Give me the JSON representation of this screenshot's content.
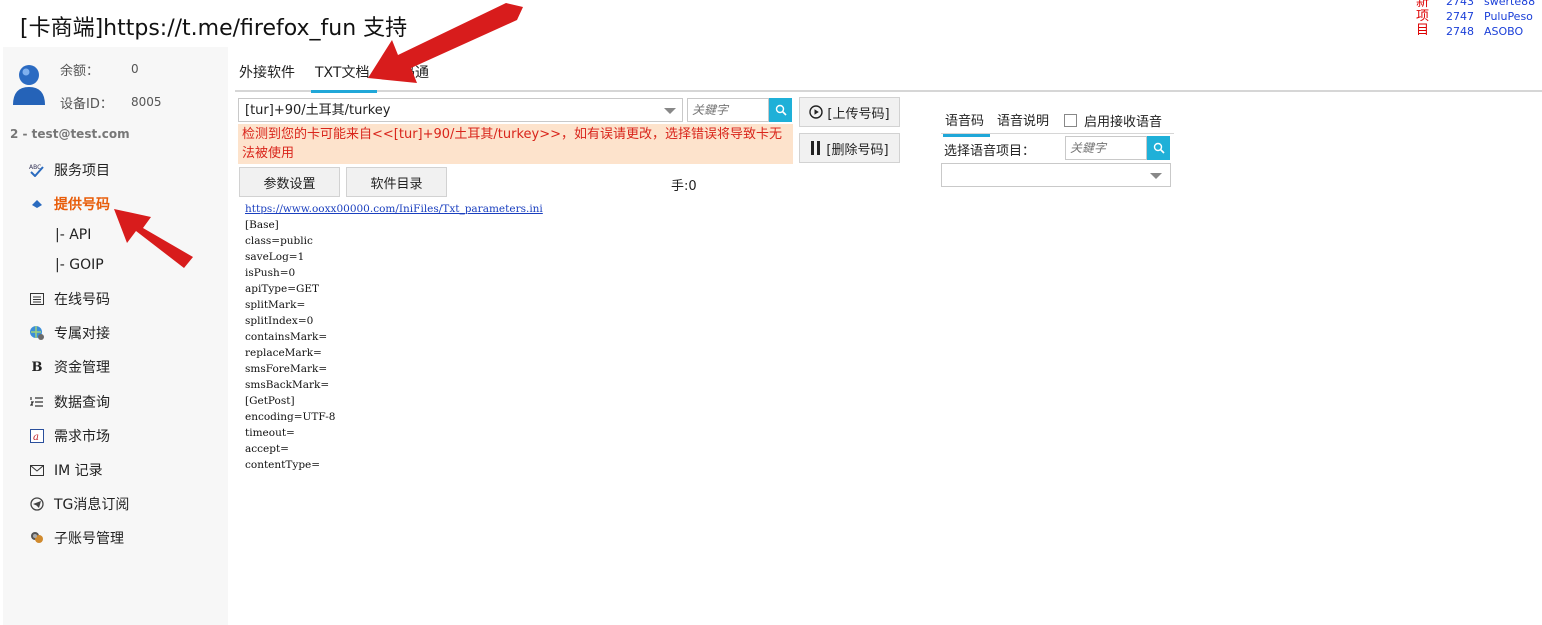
{
  "window_title": "[卡商端]https://t.me/firefox_fun 支持",
  "new_projects": {
    "label_chars": [
      "新",
      "项",
      "目"
    ],
    "items": [
      {
        "id": "2743",
        "name": "swerte88"
      },
      {
        "id": "2747",
        "name": "PuluPeso"
      },
      {
        "id": "2748",
        "name": "ASOBO"
      }
    ]
  },
  "sidebar": {
    "balance_label": "余额：",
    "balance_value": "0",
    "device_label": "设备ID：",
    "device_value": "8005",
    "account": "2 - test@test.com",
    "items": [
      {
        "label": "服务项目",
        "icon": "abc-check-icon"
      },
      {
        "label": "提供号码",
        "icon": "diamond-icon"
      },
      {
        "label": "在线号码",
        "icon": "list-box-icon"
      },
      {
        "label": "专属对接",
        "icon": "globe-link-icon"
      },
      {
        "label": "资金管理",
        "icon": "bold-b-icon"
      },
      {
        "label": "数据查询",
        "icon": "numbered-list-icon"
      },
      {
        "label": "需求市场",
        "icon": "at-sign-icon"
      },
      {
        "label": "IM 记录",
        "icon": "envelope-icon"
      },
      {
        "label": "TG消息订阅",
        "icon": "telegram-icon"
      },
      {
        "label": "子账号管理",
        "icon": "users-icon"
      }
    ],
    "sub_items": [
      "|-  API",
      "|-  GOIP"
    ]
  },
  "tabs": [
    "外接软件",
    "TXT文档",
    "一码通"
  ],
  "country_select": "[tur]+90/土耳其/turkey",
  "keyword_placeholder": "关鍵字",
  "warning": "检测到您的卡可能来自<<[tur]+90/土耳其/turkey>>，如有误请更改，选择错误将导致卡无法被使用",
  "buttons": {
    "upload": "[上传号码]",
    "delete": "[删除号码]",
    "params": "参数设置",
    "software_dir": "软件目录"
  },
  "hand_count": "手:0",
  "code": {
    "link": "https://www.ooxx00000.com/IniFiles/Txt_parameters.ini",
    "lines": [
      "[Base]",
      "class=public",
      "saveLog=1",
      "isPush=0",
      "apiType=GET",
      "splitMark=",
      "splitIndex=0",
      "containsMark=",
      "replaceMark=",
      "smsForeMark=",
      "smsBackMark=",
      "[GetPost]",
      "encoding=UTF-8",
      "timeout=",
      "accept=",
      "contentType="
    ]
  },
  "voice": {
    "tabs": [
      "语音码",
      "语音说明"
    ],
    "enable_label": "启用接收语音",
    "select_label": "选择语音项目：",
    "keyword_placeholder": "关鍵字",
    "select_value": ""
  },
  "colors": {
    "accent": "#20a7d8",
    "active_nav": "#e85d0a",
    "warning_bg": "#fde3cc",
    "warning_text": "#d9251b",
    "arrow": "#d81c1c"
  }
}
